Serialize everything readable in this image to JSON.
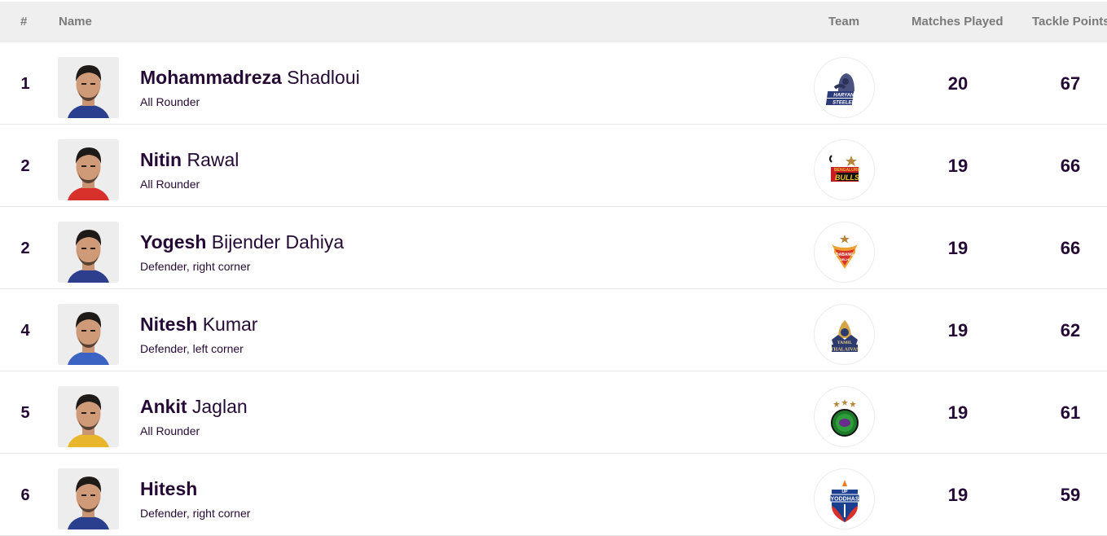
{
  "table": {
    "headers": {
      "rank": "#",
      "name": "Name",
      "team": "Team",
      "matches_played": "Matches Played",
      "tackle_points": "Tackle Points"
    },
    "rows": [
      {
        "rank": "1",
        "first_name": "Mohammadreza",
        "last_name": "Shadloui",
        "role": "All Rounder",
        "team": "Haryana Steelers",
        "team_logo": "haryana-steelers-logo",
        "matches_played": "20",
        "tackle_points": "67",
        "jersey_color": "#2b3f8f"
      },
      {
        "rank": "2",
        "first_name": "Nitin",
        "last_name": "Rawal",
        "role": "All Rounder",
        "team": "Bengaluru Bulls",
        "team_logo": "bengaluru-bulls-logo",
        "matches_played": "19",
        "tackle_points": "66",
        "jersey_color": "#d8312c"
      },
      {
        "rank": "2",
        "first_name": "Yogesh",
        "last_name": "Bijender Dahiya",
        "role": "Defender, right corner",
        "team": "Dabang Delhi K.C.",
        "team_logo": "dabang-delhi-logo",
        "matches_played": "19",
        "tackle_points": "66",
        "jersey_color": "#2c3e8c"
      },
      {
        "rank": "4",
        "first_name": "Nitesh",
        "last_name": "Kumar",
        "role": "Defender, left corner",
        "team": "Tamil Thalaivas",
        "team_logo": "tamil-thalaivas-logo",
        "matches_played": "19",
        "tackle_points": "62",
        "jersey_color": "#3b63c4"
      },
      {
        "rank": "5",
        "first_name": "Ankit",
        "last_name": "Jaglan",
        "role": "All Rounder",
        "team": "Patna Pirates",
        "team_logo": "patna-pirates-logo",
        "matches_played": "19",
        "tackle_points": "61",
        "jersey_color": "#e8b62c"
      },
      {
        "rank": "6",
        "first_name": "Hitesh",
        "last_name": "",
        "role": "Defender, right corner",
        "team": "UP Yoddhas",
        "team_logo": "up-yoddhas-logo",
        "matches_played": "19",
        "tackle_points": "59",
        "jersey_color": "#2b3f8f"
      }
    ]
  }
}
